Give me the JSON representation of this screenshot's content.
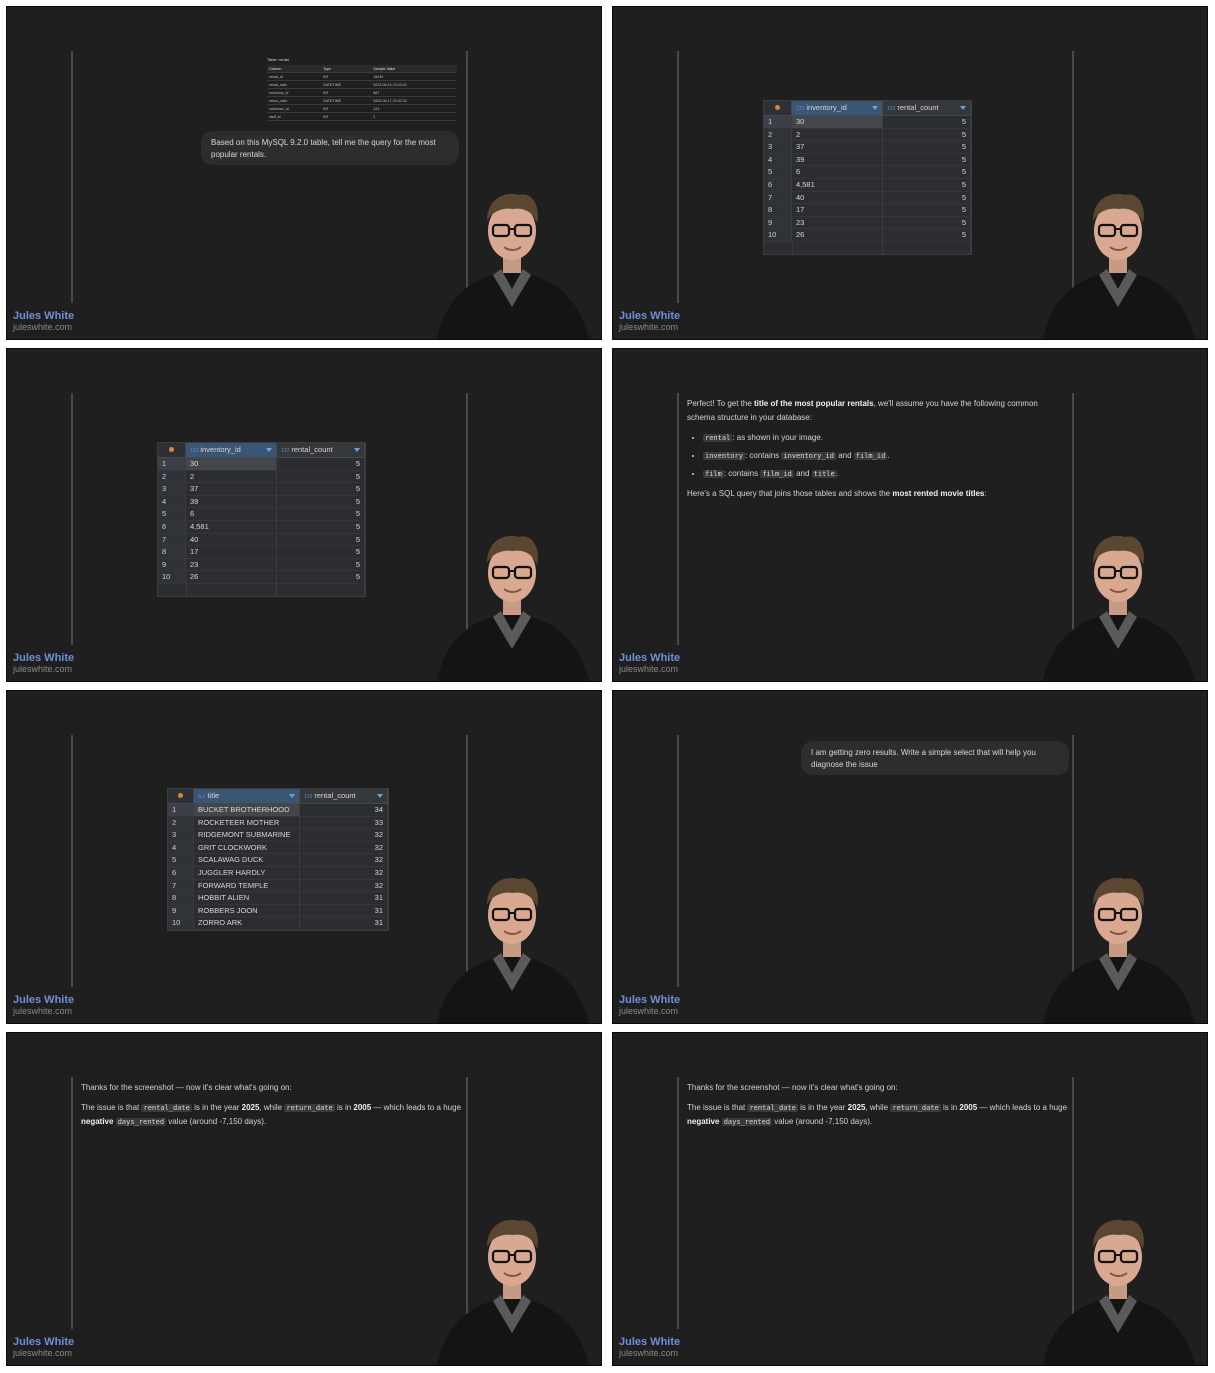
{
  "brand": {
    "name": "Jules White",
    "url": "juleswhite.com"
  },
  "p1": {
    "schema_title": "Table: rental",
    "schema_headers": [
      "Column",
      "Type",
      "Sample Value"
    ],
    "schema_rows": [
      [
        "rental_id",
        "INT",
        "16049"
      ],
      [
        "rental_date",
        "DATETIME",
        "2025-06-14 22:03:33"
      ],
      [
        "inventory_id",
        "INT",
        "867"
      ],
      [
        "return_date",
        "DATETIME",
        "2005-06-17 20:32:33"
      ],
      [
        "customer_id",
        "INT",
        "224"
      ],
      [
        "staff_id",
        "INT",
        "2"
      ]
    ],
    "bubble": "Based on this MySQL 9.2.0 table, tell me the query for the most popular rentals."
  },
  "grid_inv": {
    "col1": "inventory_id",
    "col2": "rental_count",
    "rows": [
      [
        "1",
        "30",
        "5"
      ],
      [
        "2",
        "2",
        "5"
      ],
      [
        "3",
        "37",
        "5"
      ],
      [
        "4",
        "39",
        "5"
      ],
      [
        "5",
        "6",
        "5"
      ],
      [
        "6",
        "4,581",
        "5"
      ],
      [
        "7",
        "40",
        "5"
      ],
      [
        "8",
        "17",
        "5"
      ],
      [
        "9",
        "23",
        "5"
      ],
      [
        "10",
        "26",
        "5"
      ]
    ]
  },
  "p4": {
    "intro_pre": "Perfect! To get the ",
    "intro_bold": "title of the most popular rentals",
    "intro_post": ", we'll assume you have the following common schema structure in your database:",
    "b1_code": "rental",
    "b1_text": ": as shown in your image.",
    "b2_code": "inventory",
    "b2_text1": ": contains ",
    "b2_code2": "inventory_id",
    "b2_text2": " and ",
    "b2_code3": "film_id",
    "b2_text3": ".",
    "b3_code": "film",
    "b3_text1": ": contains ",
    "b3_code2": "film_id",
    "b3_text2": " and ",
    "b3_code3": "title",
    "b3_text3": ".",
    "outro_pre": "Here's a SQL query that joins those tables and shows the ",
    "outro_bold": "most rented movie titles",
    "outro_post": ":"
  },
  "grid_title": {
    "col1": "title",
    "col2": "rental_count",
    "rows": [
      [
        "1",
        "BUCKET BROTHERHOOD",
        "34"
      ],
      [
        "2",
        "ROCKETEER MOTHER",
        "33"
      ],
      [
        "3",
        "RIDGEMONT SUBMARINE",
        "32"
      ],
      [
        "4",
        "GRIT CLOCKWORK",
        "32"
      ],
      [
        "5",
        "SCALAWAG DUCK",
        "32"
      ],
      [
        "6",
        "JUGGLER HARDLY",
        "32"
      ],
      [
        "7",
        "FORWARD TEMPLE",
        "32"
      ],
      [
        "8",
        "HOBBIT ALIEN",
        "31"
      ],
      [
        "9",
        "ROBBERS JOON",
        "31"
      ],
      [
        "10",
        "ZORRO ARK",
        "31"
      ]
    ]
  },
  "p6": {
    "bubble": "I am getting zero results. Write a simple select that will help you diagnose the issue"
  },
  "p7": {
    "line1": "Thanks for the screenshot — now it's clear what's going on:",
    "l2_a": "The issue is that ",
    "l2_code1": "rental_date",
    "l2_b": " is in the year ",
    "l2_bold1": "2025",
    "l2_c": ", while ",
    "l2_code2": "return_date",
    "l2_d": " is in ",
    "l2_bold2": "2005",
    "l2_e": " — which leads to a huge ",
    "l2_bold3": "negative",
    "l2_f": " ",
    "l2_code3": "days_rented",
    "l2_g": " value (around -7,150 days)."
  }
}
